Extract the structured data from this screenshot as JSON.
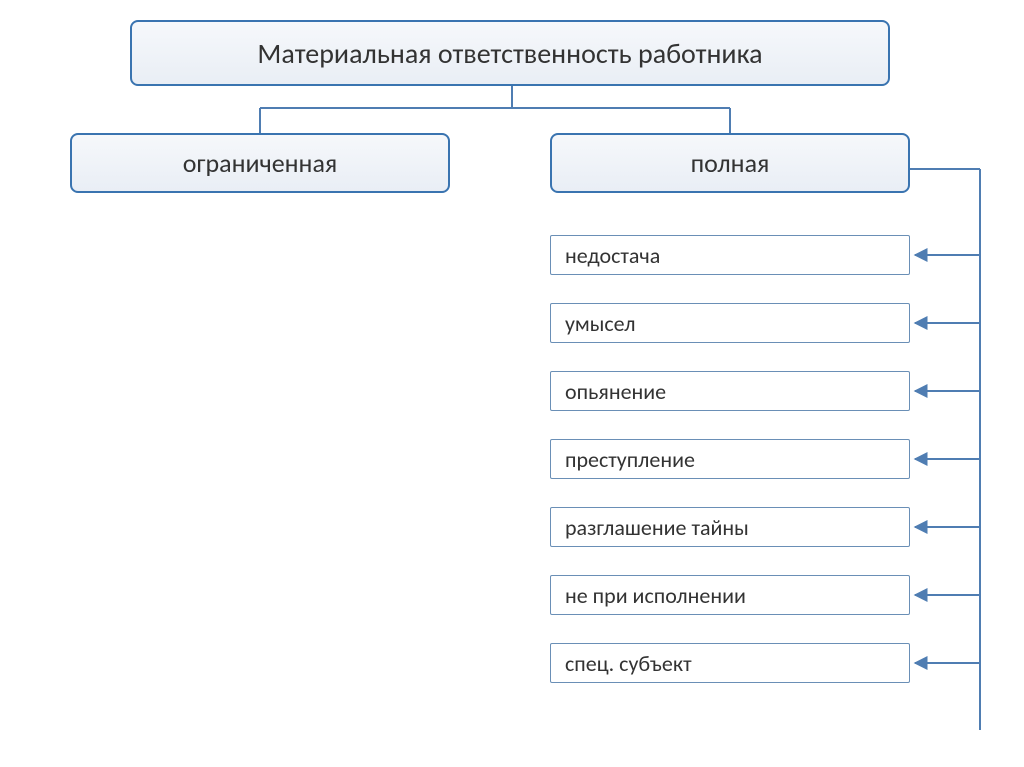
{
  "root": "Материальная ответственность работника",
  "children": {
    "left": {
      "label": "ограниченная"
    },
    "right": {
      "label": "полная",
      "items": [
        "недостача",
        "умысел",
        "опьянение",
        "преступление",
        "разглашение тайны",
        "не при исполнении",
        "спец. субъект"
      ]
    }
  },
  "colors": {
    "line": "#4f7db2",
    "border": "#3a74b0"
  }
}
